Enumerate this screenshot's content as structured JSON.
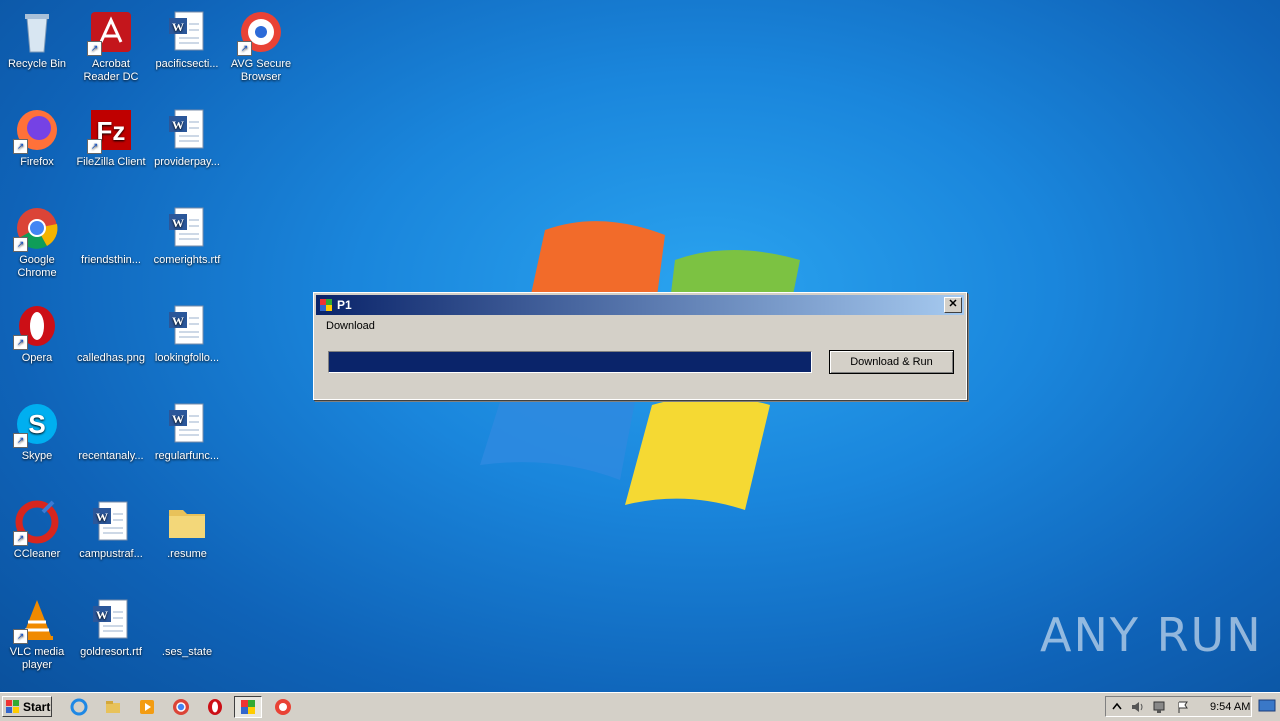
{
  "desktop": {
    "icons": [
      {
        "label": "Recycle Bin",
        "icon": "recycle-bin-icon"
      },
      {
        "label": "Acrobat Reader DC",
        "icon": "acrobat-icon"
      },
      {
        "label": "pacificsecti...",
        "icon": "word-doc-icon"
      },
      {
        "label": "AVG Secure Browser",
        "icon": "avg-browser-icon"
      },
      {
        "label": "Firefox",
        "icon": "firefox-icon"
      },
      {
        "label": "FileZilla Client",
        "icon": "filezilla-icon"
      },
      {
        "label": "providerpay...",
        "icon": "word-doc-icon"
      },
      {
        "label": "Google Chrome",
        "icon": "chrome-icon"
      },
      {
        "label": "friendsthin...",
        "icon": "blank-file-icon"
      },
      {
        "label": "comerights.rtf",
        "icon": "word-doc-icon"
      },
      {
        "label": "Opera",
        "icon": "opera-icon"
      },
      {
        "label": "calledhas.png",
        "icon": "blank-file-icon"
      },
      {
        "label": "lookingfollo...",
        "icon": "word-doc-icon"
      },
      {
        "label": "Skype",
        "icon": "skype-icon"
      },
      {
        "label": "recentanaly...",
        "icon": "blank-file-icon"
      },
      {
        "label": "regularfunc...",
        "icon": "word-doc-icon"
      },
      {
        "label": "CCleaner",
        "icon": "ccleaner-icon"
      },
      {
        "label": "campustraf...",
        "icon": "word-doc-icon"
      },
      {
        "label": ".resume",
        "icon": "folder-icon"
      },
      {
        "label": "VLC media player",
        "icon": "vlc-icon"
      },
      {
        "label": "goldresort.rtf",
        "icon": "word-doc-icon"
      },
      {
        "label": ".ses_state",
        "icon": "blank-file-icon"
      }
    ],
    "watermark": "ANY RUN"
  },
  "dialog": {
    "title": "P1",
    "label": "Download",
    "progress_fraction": 1.0,
    "button_label": "Download & Run",
    "close_glyph": "✕"
  },
  "taskbar": {
    "start_label": "Start",
    "clock": "9:54 AM",
    "pinned": [
      "ie-icon",
      "explorer-icon",
      "media-player-icon",
      "chrome-icon",
      "opera-icon",
      "p1-app-icon",
      "avg-browser-icon"
    ],
    "tray": [
      "show-hidden-icon",
      "volume-icon",
      "network-icon",
      "action-center-flag-icon"
    ]
  }
}
